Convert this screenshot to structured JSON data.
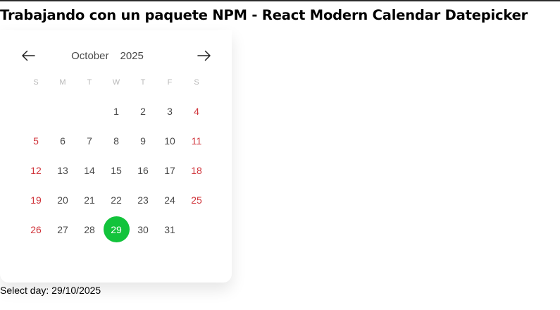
{
  "page": {
    "title": "Trabajando con un paquete NPM - React Modern Calendar Datepicker",
    "selected_label": "Select day: 29/10/2025"
  },
  "calendar": {
    "month": "October",
    "year": "2025",
    "prev_icon": "arrow-left-icon",
    "next_icon": "arrow-right-icon",
    "weekdays": [
      "S",
      "M",
      "T",
      "W",
      "T",
      "F",
      "S"
    ],
    "days": [
      "",
      "",
      "",
      "1",
      "2",
      "3",
      "4",
      "5",
      "6",
      "7",
      "8",
      "9",
      "10",
      "11",
      "12",
      "13",
      "14",
      "15",
      "16",
      "17",
      "18",
      "19",
      "20",
      "21",
      "22",
      "23",
      "24",
      "25",
      "26",
      "27",
      "28",
      "29",
      "30",
      "31",
      ""
    ],
    "selected_day": "29",
    "colors": {
      "selected": "#12c33b",
      "weekend": "#d0343b",
      "weekday_header": "#b8b8b8",
      "text": "#4a4a4a"
    }
  }
}
